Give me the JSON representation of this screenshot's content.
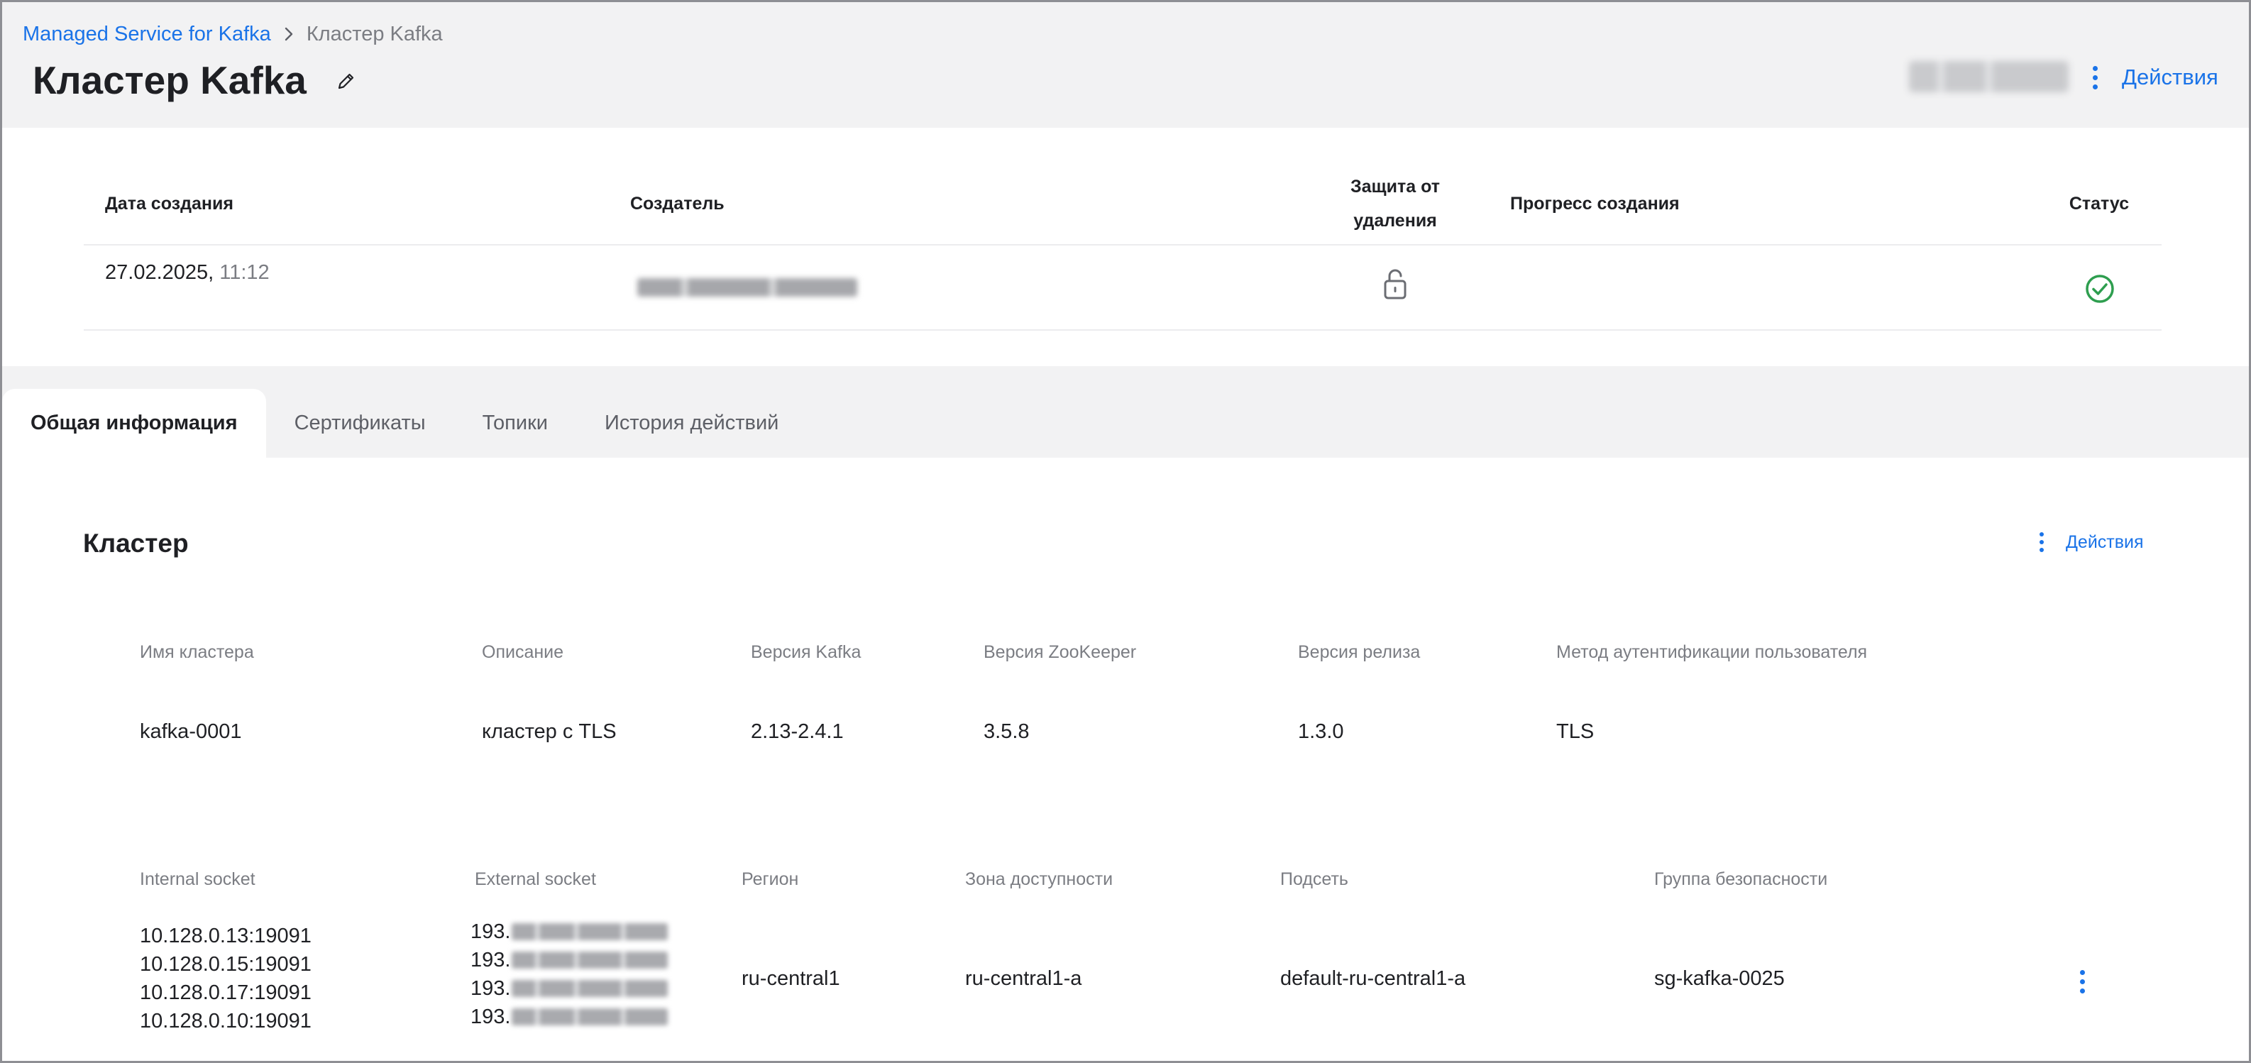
{
  "breadcrumb": {
    "service": "Managed Service for Kafka",
    "current": "Кластер Kafka"
  },
  "header": {
    "title": "Кластер Kafka",
    "actions_label": "Действия"
  },
  "info_table": {
    "columns": {
      "created": "Дата создания",
      "creator": "Создатель",
      "protection": "Защита от удаления",
      "progress": "Прогресс создания",
      "status": "Статус"
    },
    "row": {
      "created_date": "27.02.2025,",
      "created_time": "11:12",
      "protection_icon": "unlocked-icon",
      "status_icon": "check-circle-icon"
    }
  },
  "tabs": [
    {
      "label": "Общая информация",
      "active": true
    },
    {
      "label": "Сертификаты",
      "active": false
    },
    {
      "label": "Топики",
      "active": false
    },
    {
      "label": "История действий",
      "active": false
    }
  ],
  "cluster": {
    "title": "Кластер",
    "actions_label": "Действия",
    "fields": {
      "name_label": "Имя кластера",
      "name": "kafka-0001",
      "description_label": "Описание",
      "description": "кластер с TLS",
      "kafka_version_label": "Версия Kafka",
      "kafka_version": "2.13-2.4.1",
      "zookeeper_version_label": "Версия ZooKeeper",
      "zookeeper_version": "3.5.8",
      "release_version_label": "Версия релиза",
      "release_version": "1.3.0",
      "auth_method_label": "Метод аутентификации пользователя",
      "auth_method": "TLS"
    },
    "network": {
      "internal_socket_label": "Internal socket",
      "internal_sockets": [
        "10.128.0.13:19091",
        "10.128.0.15:19091",
        "10.128.0.17:19091",
        "10.128.0.10:19091"
      ],
      "external_socket_label": "External socket",
      "external_socket_prefixes": [
        "193.",
        "193.",
        "193.",
        "193."
      ],
      "region_label": "Регион",
      "region": "ru-central1",
      "zone_label": "Зона доступности",
      "zone": "ru-central1-a",
      "subnet_label": "Подсеть",
      "subnet": "default-ru-central1-a",
      "security_group_label": "Группа безопасности",
      "security_group": "sg-kafka-0025"
    }
  },
  "colors": {
    "accent": "#1a73e8",
    "status_ok": "#2e9e4f",
    "page_bg": "#f2f2f3"
  }
}
